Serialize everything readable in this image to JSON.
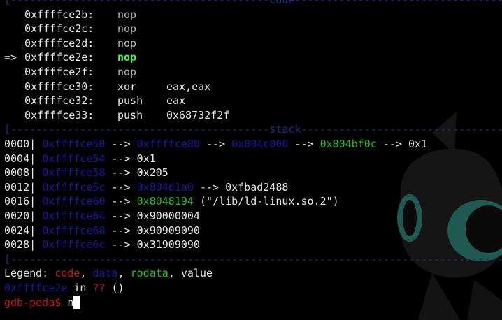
{
  "code_section": {
    "title": "code",
    "rows": [
      {
        "marker": "",
        "address": "0xffffce2b:",
        "mnemonic": "nop",
        "operands": "",
        "current": false
      },
      {
        "marker": "",
        "address": "0xffffce2c:",
        "mnemonic": "nop",
        "operands": "",
        "current": false
      },
      {
        "marker": "",
        "address": "0xffffce2d:",
        "mnemonic": "nop",
        "operands": "",
        "current": false
      },
      {
        "marker": "=>",
        "address": "0xffffce2e:",
        "mnemonic": "nop",
        "operands": "",
        "current": true
      },
      {
        "marker": "",
        "address": "0xffffce2f:",
        "mnemonic": "nop",
        "operands": "",
        "current": false
      },
      {
        "marker": "",
        "address": "0xffffce30:",
        "mnemonic": "xor",
        "operands": "eax,eax",
        "current": false
      },
      {
        "marker": "",
        "address": "0xffffce32:",
        "mnemonic": "push",
        "operands": "eax",
        "current": false
      },
      {
        "marker": "",
        "address": "0xffffce33:",
        "mnemonic": "push",
        "operands": "0x68732f2f",
        "current": false
      }
    ]
  },
  "stack_section": {
    "title": "stack",
    "rows": [
      {
        "offset": "0000|",
        "parts": [
          "0xffffce50",
          " --> ",
          "0xffffce80",
          " --> ",
          "0x804c000",
          " --> ",
          "0x804bf0c",
          " --> ",
          "0x1"
        ]
      },
      {
        "offset": "0004|",
        "parts": [
          "0xffffce54",
          " --> ",
          "0x1"
        ]
      },
      {
        "offset": "0008|",
        "parts": [
          "0xffffce58",
          " --> ",
          "0x205"
        ]
      },
      {
        "offset": "0012|",
        "parts": [
          "0xffffce5c",
          " --> ",
          "0x804d1a0",
          " --> ",
          "0xfbad2488"
        ]
      },
      {
        "offset": "0016|",
        "parts": [
          "0xffffce60",
          " --> ",
          "0x8048194",
          " (\"/lib/ld-linux.so.2\")"
        ]
      },
      {
        "offset": "0020|",
        "parts": [
          "0xffffce64",
          " --> ",
          "0x90000004"
        ]
      },
      {
        "offset": "0024|",
        "parts": [
          "0xffffce68",
          " --> ",
          "0x90909090"
        ]
      },
      {
        "offset": "0028|",
        "parts": [
          "0xffffce6c",
          " --> ",
          "0x31909090"
        ]
      }
    ]
  },
  "legend": {
    "label": "Legend: ",
    "code": "code",
    "data": "data",
    "rodata": "rodata",
    "value": "value",
    "sep": ", "
  },
  "location": {
    "address": "0xffffce2e",
    "text": " in ",
    "func": "??",
    "args": " ()"
  },
  "prompt": {
    "label": "gdb-peda$",
    "input": "n"
  },
  "colors": {
    "code": "#c01818",
    "data": "#1a1a99",
    "rodata": "#2db82d",
    "value": "#e6e6e6",
    "current_instruction": "#4cf54c",
    "separator": "#1f2d7a"
  }
}
